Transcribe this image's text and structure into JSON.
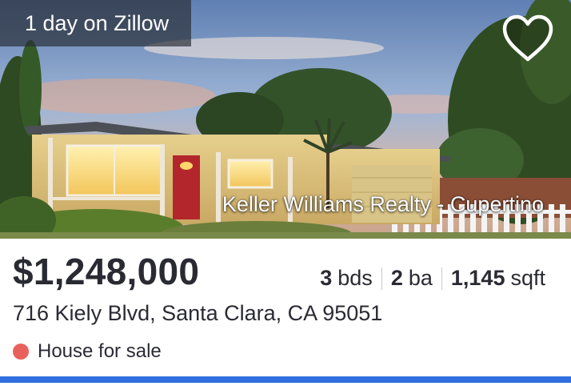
{
  "listing": {
    "days_on_site": "1 day on Zillow",
    "agency": "Keller Williams Realty - Cupertino",
    "price": "$1,248,000",
    "beds": {
      "value": "3",
      "unit": "bds"
    },
    "baths": {
      "value": "2",
      "unit": "ba"
    },
    "area": {
      "value": "1,145",
      "unit": "sqft"
    },
    "address": "716 Kiely Blvd, Santa Clara, CA 95051",
    "status": "House for sale",
    "status_color": "#e8615c",
    "favorite_icon": "heart-outline-icon"
  },
  "colors": {
    "accent_bar": "#2f6fdd",
    "text": "#2a2a33"
  }
}
